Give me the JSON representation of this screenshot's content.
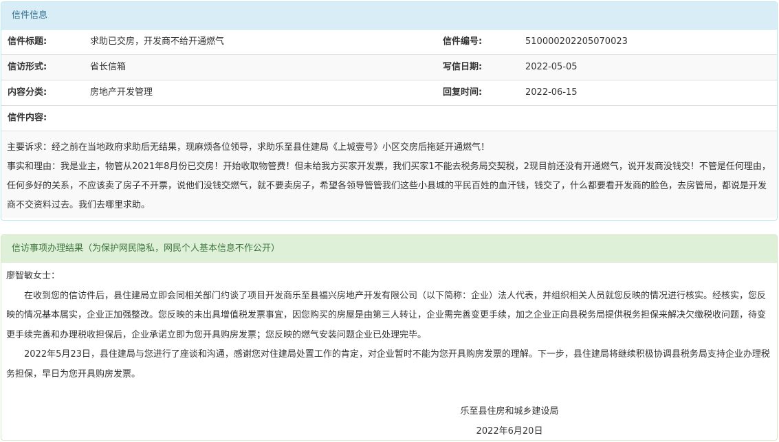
{
  "letter_info": {
    "header": "信件信息",
    "rows": [
      {
        "label1": "信件标题:",
        "value1": "求助已交房，开发商不给开通燃气",
        "label2": "信件编号:",
        "value2": "510000202205070023"
      },
      {
        "label1": "信访形式:",
        "value1": "省长信箱",
        "label2": "写信日期:",
        "value2": "2022-05-05"
      },
      {
        "label1": "内容分类:",
        "value1": "房地产开发管理",
        "label2": "回复时间:",
        "value2": "2022-06-15"
      }
    ],
    "content_label": "信件内容:",
    "content_lines": [
      "主要诉求：经之前在当地政府求助后无结果，现麻烦各位领导，求助乐至县住建局《上城壹号》小区交房后拖延开通燃气！",
      "事实和理由：我是业主，物管从2021年8月份已交房！开始收取物管费！但未给我方买家开发票，我们买家1不能去税务局交契税，2现目前还没有开通燃气，说开发商没钱交！不管是任何理由，任何多好的关系，不应该卖了房子不开票，说他们没钱交燃气，就不要卖房子，希望各领导管管我们这些小县城的平民百姓的血汗钱，钱交了，什么都要看开发商的脸色，去房管局，都说是开发商不交资料过去。我们去哪里求助。"
    ]
  },
  "reply": {
    "header": "信访事项办理结果（为保护网民隐私，网民个人基本信息不作公开）",
    "salutation": "廖智敏女士：",
    "paragraphs": [
      "在收到您的信访件后，县住建局立即会同相关部门约谈了项目开发商乐至县福兴房地产开发有限公司（以下简称：企业）法人代表，并组织相关人员就您反映的情况进行核实。经核实，您反映的情况基本属实，企业正加强整改。您反映的未出具增值税发票事宜，因您购买的房屋是由第三人转让，企业需完善变更手续，加之企业正向县税务局提供税务担保来解决欠缴税收问题，待变更手续完善和办理税收担保后，企业承诺立即为您开具购房发票；您反映的燃气安装问题企业已处理完毕。",
      "2022年5月23日，县住建局与您进行了座谈和沟通，感谢您对住建局处置工作的肯定，对企业暂时不能为您开具购房发票的理解。下一步，县住建局将继续积极协调县税务局支持企业办理税务担保，早日为您开具购房发票。"
    ],
    "signature": "乐至县住房和城乡建设局",
    "date": "2022年6月20日"
  }
}
